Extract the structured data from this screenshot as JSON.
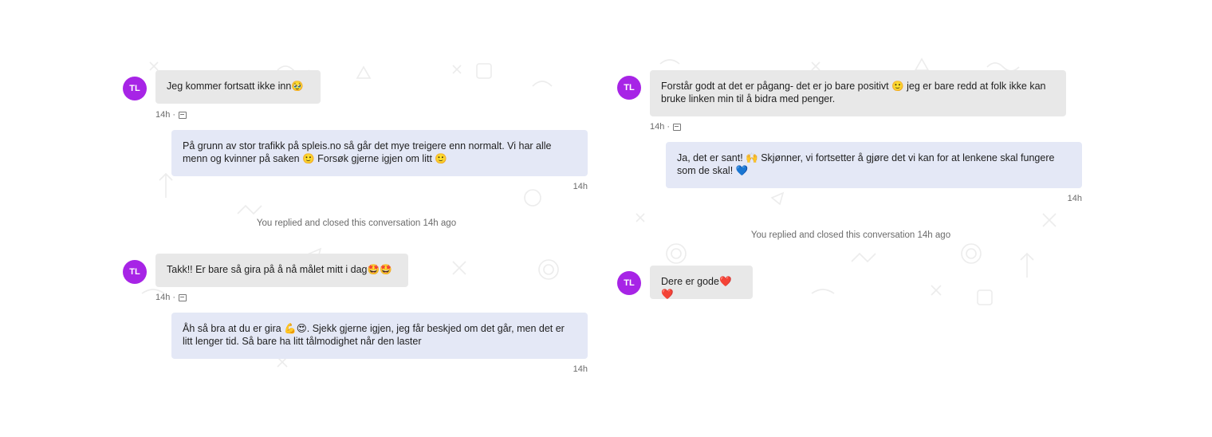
{
  "left": {
    "messages": [
      {
        "avatar": "TL",
        "text": "Jeg kommer fortsatt ikke inn🥹",
        "meta": "14h ·"
      },
      {
        "text": "På grunn av stor trafikk på spleis.no så går det mye treigere enn normalt. Vi har alle menn og kvinner på saken 🙂 Forsøk gjerne igjen om litt 🙂",
        "time": "14h"
      },
      {
        "system": "You replied and closed this conversation 14h ago"
      },
      {
        "avatar": "TL",
        "text": "Takk!! Er bare så gira på å nå målet mitt i dag🤩🤩",
        "meta": "14h ·"
      },
      {
        "text": "Åh så bra at du er gira 💪😍. Sjekk gjerne igjen, jeg får beskjed om det går, men det er litt lenger tid. Så bare ha litt tålmodighet når den laster",
        "time": "14h"
      }
    ]
  },
  "right": {
    "messages": [
      {
        "avatar": "TL",
        "text": "Forstår godt at det er pågang- det er jo bare positivt 🙂 jeg er bare redd at folk ikke kan bruke linken min til å bidra med penger.",
        "meta": "14h ·"
      },
      {
        "text": "Ja, det er sant! 🙌 Skjønner, vi fortsetter å gjøre det vi kan for at lenkene skal fungere som de skal! 💙",
        "time": "14h"
      },
      {
        "system": "You replied and closed this conversation 14h ago"
      },
      {
        "avatar": "TL",
        "text": "Dere er gode❤️❤️"
      }
    ]
  },
  "colors": {
    "avatar": "#a724e6",
    "incoming_bubble": "#e8e8e8",
    "outgoing_bubble": "#e4e8f6"
  }
}
